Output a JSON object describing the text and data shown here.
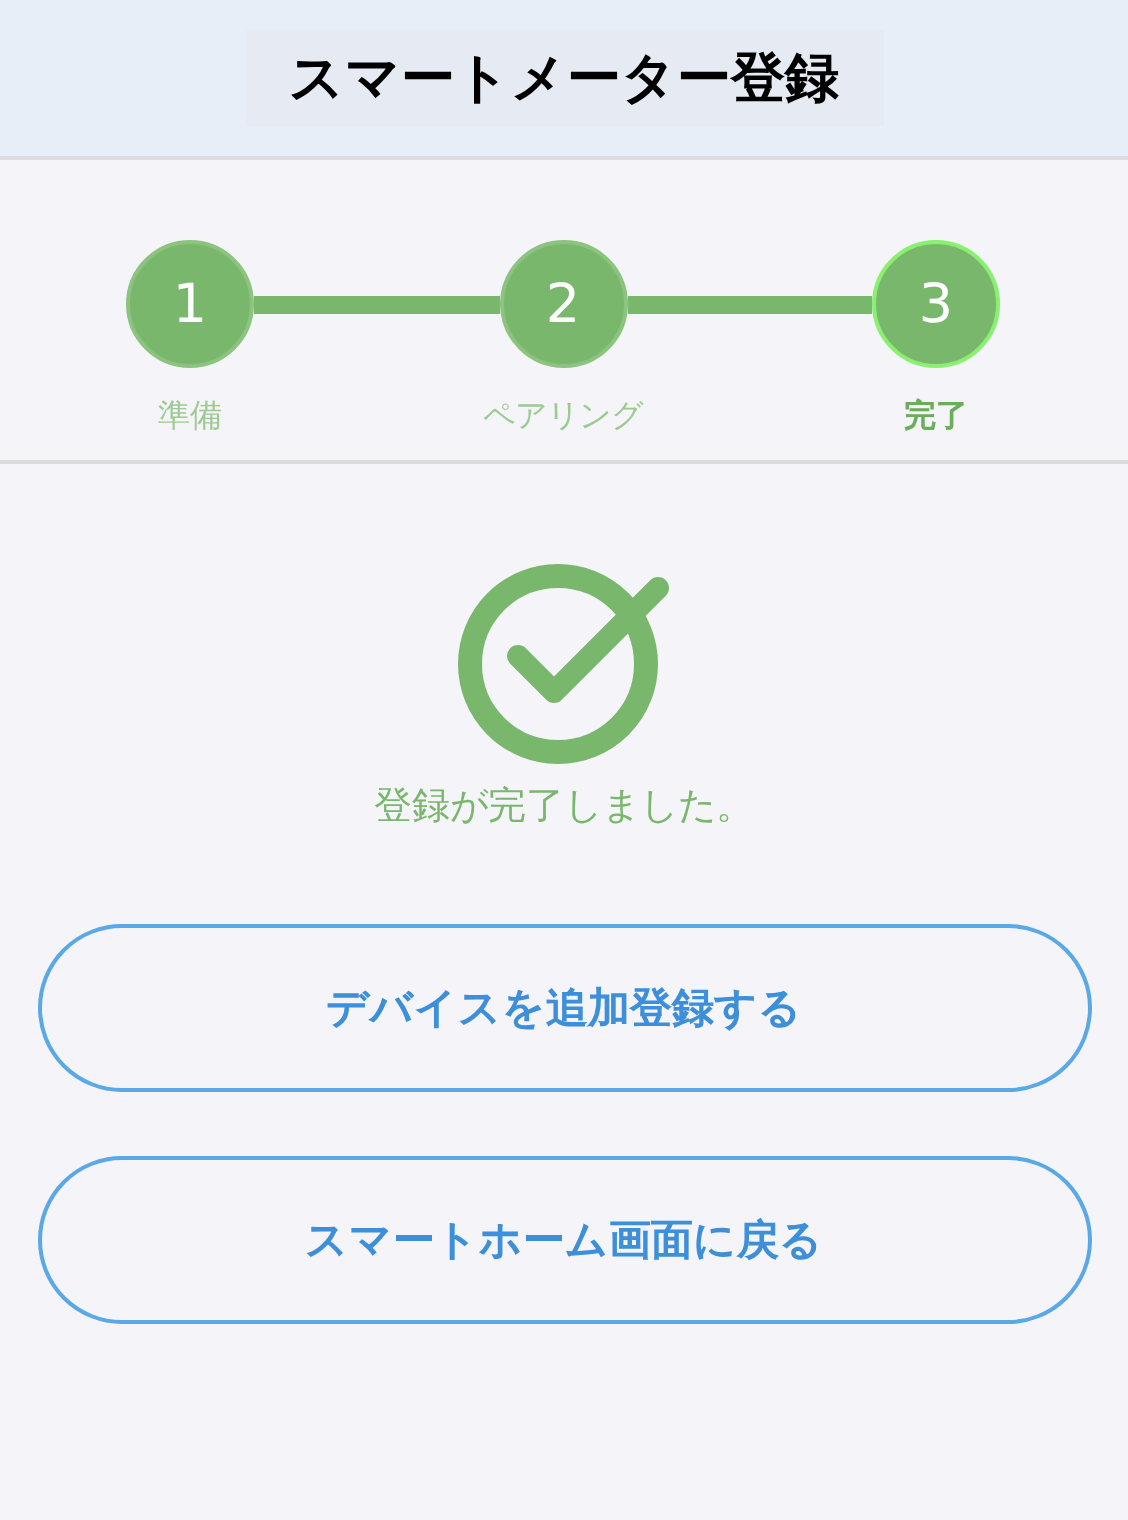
{
  "header": {
    "title": "スマートメーター登録"
  },
  "steps": [
    {
      "number": "1",
      "label": "準備",
      "selected": false
    },
    {
      "number": "2",
      "label": "ペアリング",
      "selected": false
    },
    {
      "number": "3",
      "label": "完了",
      "selected": true
    }
  ],
  "message": "登録が完了しました。",
  "buttons": [
    "デバイスを追加登録する",
    "スマートホーム画面に戻る"
  ]
}
